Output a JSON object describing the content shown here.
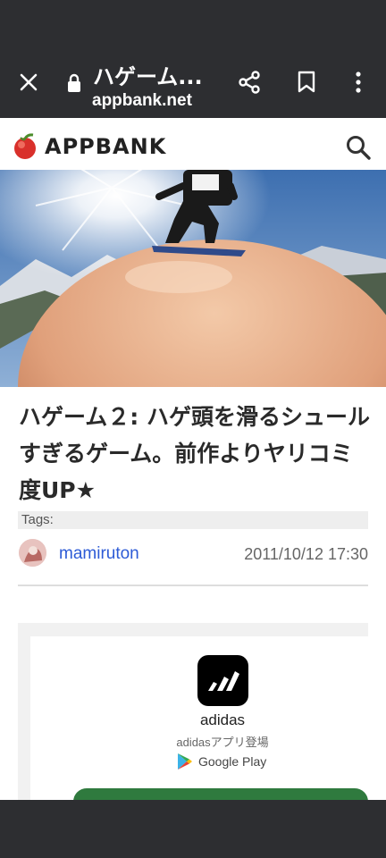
{
  "browser": {
    "title": "ハゲーム...",
    "url": "appbank.net"
  },
  "site": {
    "logo_text": "APPBANK"
  },
  "article": {
    "title": "ハゲーム２: ハゲ頭を滑るシュールすぎるゲーム。前作よりヤリコミ度UP★",
    "tags_label": "Tags:",
    "author": "mamiruton",
    "date": "2011/10/12 17:30"
  },
  "ad": {
    "app_name": "adidas",
    "subtitle": "adidasアプリ登場",
    "store": "Google Play"
  },
  "colors": {
    "chrome": "#2d2e31",
    "author_link": "#2d5bd6",
    "ad_button": "#2f7a3e"
  }
}
